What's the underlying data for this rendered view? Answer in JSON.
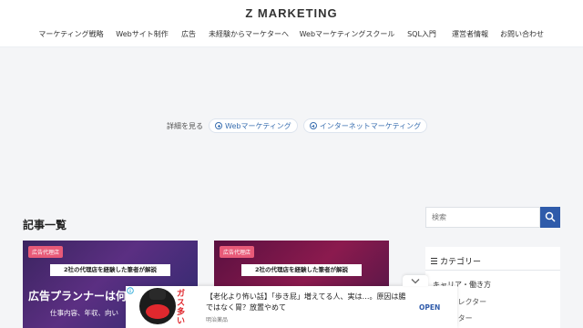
{
  "site": {
    "title": "Z MARKETING"
  },
  "nav": [
    "マーケティング戦略",
    "Webサイト制作",
    "広告",
    "未経験からマーケターへ",
    "Webマーケティングスクール",
    "SQL入門",
    "運営者情報",
    "お問い合わせ"
  ],
  "details": {
    "label": "詳細を見る",
    "tags": [
      "Webマーケティング",
      "インターネットマーケティング"
    ]
  },
  "articles": {
    "heading": "記事一覧",
    "cards": [
      {
        "badge": "広告代理店",
        "banner": "2社の代理店を経験した筆者が解説",
        "headline": "広告プランナーは何",
        "sub": "仕事内容、年収、向い",
        "bg": "#4b2a72"
      },
      {
        "badge": "広告代理店",
        "banner": "2社の代理店を経験した筆者が解説",
        "headline": "",
        "sub": "",
        "bg": "#7a1848"
      }
    ]
  },
  "sidebar": {
    "search_placeholder": "検索",
    "category_title": "カテゴリー",
    "categories": [
      {
        "label": "キャリア・働き方",
        "level": 1
      },
      {
        "label": "ディレクター",
        "level": 2
      },
      {
        "label": "ライター",
        "level": 2
      }
    ]
  },
  "ad": {
    "image_text": "ガス多い",
    "text": "【老化より怖い話】「歩き屁」増えてる人、実は…。原因は腸ではなく胃？放置やめて",
    "source": "明治薬品",
    "cta": "OPEN",
    "colors": {
      "accent": "#e0282e",
      "cta": "#2f5baa"
    }
  },
  "colors": {
    "header_bg": "#ffffff",
    "page_bg": "#f4f5f7",
    "link": "#3a6fb0",
    "search_button": "#2f5baa",
    "badge": "#e85a78"
  }
}
